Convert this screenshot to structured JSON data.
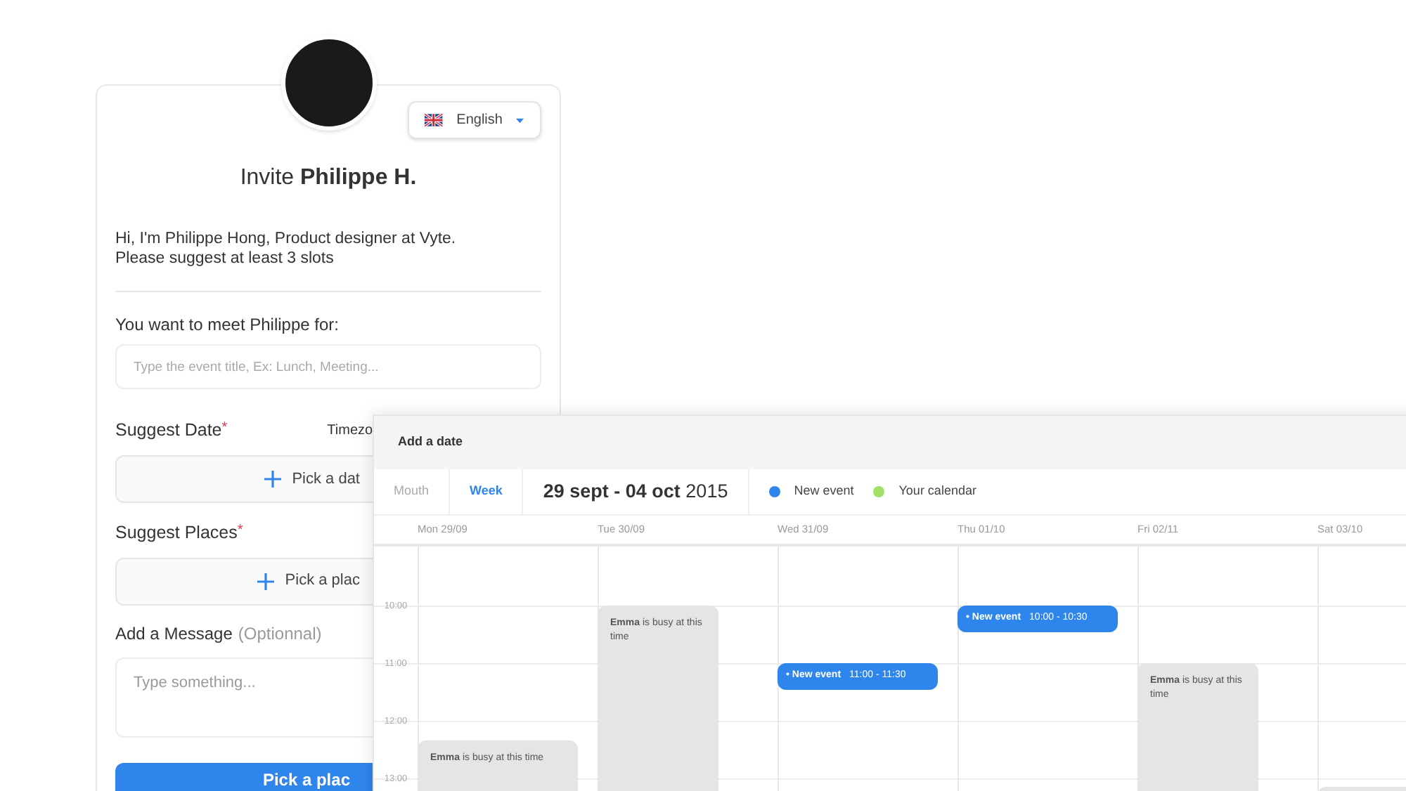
{
  "invite_card": {
    "language": {
      "label": "English"
    },
    "title": "Invite **Philippe H.**",
    "intro": [
      "Hi, I'm Philippe Hong, Product designer at Vyte.",
      "Please suggest at least 3 slots"
    ],
    "meet_label": "You want to meet Philippe for:",
    "event_title": {
      "placeholder": "Type the event title, Ex: Lunch, Meeting..."
    },
    "date_section": {
      "label": "Suggest Date",
      "required_mark": "*",
      "timezone": "Timezo",
      "pick": "Pick a dat"
    },
    "places_section": {
      "label": "Suggest Places",
      "required_mark": "*",
      "pick": "Pick a plac"
    },
    "message_section": {
      "label": "Add a Message",
      "hint": "(Optionnal)",
      "placeholder": "Type something..."
    },
    "submit": "Pick a plac"
  },
  "calendar": {
    "title": "Add a date",
    "views": [
      {
        "label": "Mouth",
        "selected": false
      },
      {
        "label": "Week",
        "selected": true
      }
    ],
    "range": "**29 sept - 04 oct** 2015",
    "legend": [
      {
        "label": "New event",
        "color": "#2e86ec"
      },
      {
        "label": "Your calendar",
        "color": "#a3e067"
      }
    ],
    "days": [
      {
        "label": "Mon 29/09",
        "event": {
          "kind": "busy",
          "name": "Emma",
          "text": "is busy at this time"
        }
      },
      {
        "label": "Tue 30/09",
        "event": {
          "kind": "busy",
          "name": "Emma",
          "text": "is busy at this time"
        }
      },
      {
        "label": "Wed 31/09",
        "event": {
          "kind": "new",
          "name": "• New event",
          "text": "11:00 - 11:30"
        }
      },
      {
        "label": "Thu 01/10",
        "event": {
          "kind": "new",
          "name": "• New event",
          "text": "10:00 - 10:30"
        }
      },
      {
        "label": "Fri 02/11",
        "event": {
          "kind": "busy",
          "name": "Emma",
          "text": "is busy at this time"
        }
      },
      {
        "label": "Sat 03/10",
        "event": {
          "kind": "busy"
        }
      }
    ],
    "times": [
      "10:00",
      "11:00",
      "12:00",
      "13:00"
    ]
  }
}
